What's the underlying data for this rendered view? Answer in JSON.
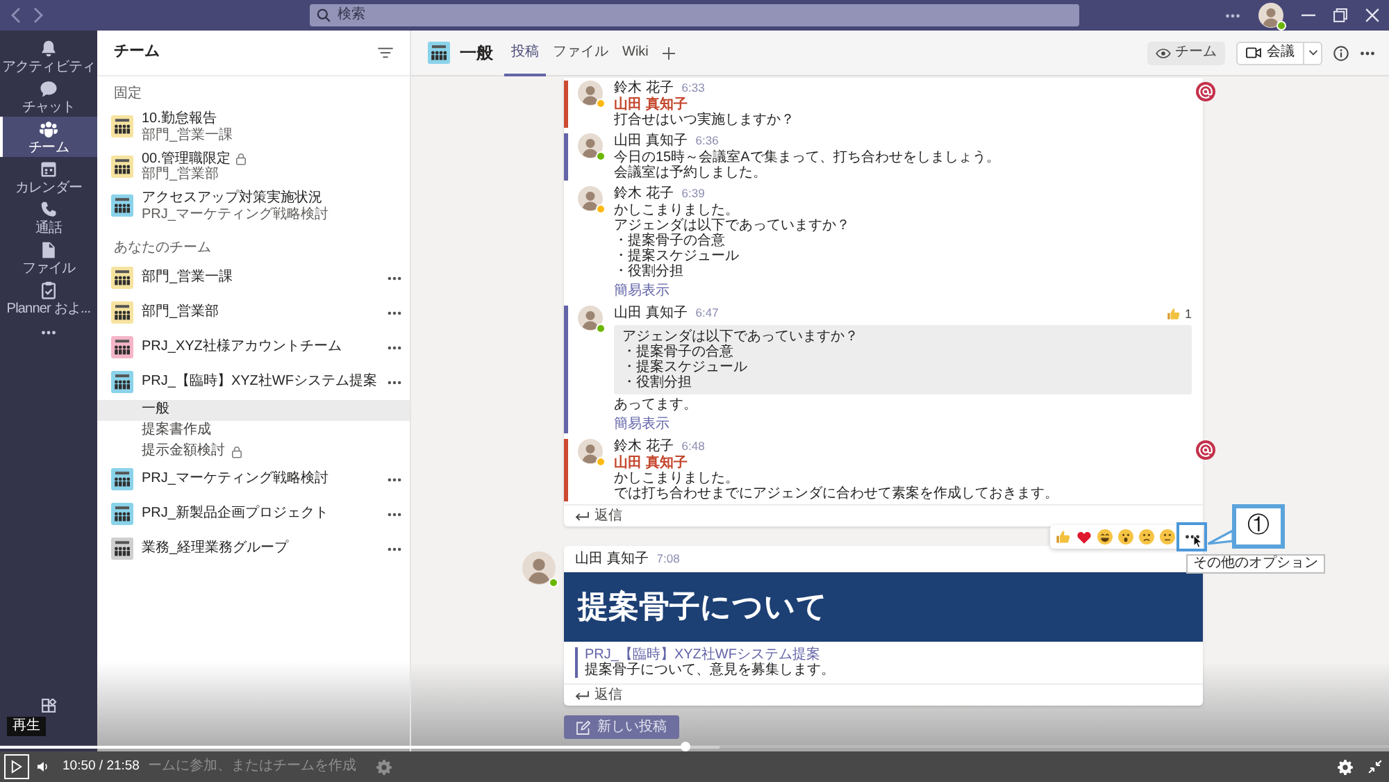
{
  "title_bar": {
    "search": {
      "placeholder": "検索"
    }
  },
  "rail": {
    "items": [
      {
        "label": "アクティビティ",
        "selected": false
      },
      {
        "label": "チャット",
        "selected": false
      },
      {
        "label": "チーム",
        "selected": true
      },
      {
        "label": "カレンダー",
        "selected": false
      },
      {
        "label": "通話",
        "selected": false
      },
      {
        "label": "ファイル",
        "selected": false
      },
      {
        "label": "Planner およ...",
        "selected": false
      }
    ]
  },
  "teams_panel": {
    "title": "チーム",
    "pinned": {
      "heading": "固定",
      "items": [
        {
          "name": "10.勤怠報告",
          "team": "部門_営業一課",
          "color": "#f6e3a0",
          "private": false
        },
        {
          "name": "00.管理職限定",
          "team": "部門_営業部",
          "color": "#f6e3a0",
          "private": true
        },
        {
          "name": "アクセスアップ対策実施状況",
          "team": "PRJ_マーケティング戦略検討",
          "color": "#8ad3ea",
          "private": false
        }
      ]
    },
    "your_teams": {
      "heading": "あなたのチーム",
      "items": [
        {
          "name": "部門_営業一課",
          "color": "#f6e3a0"
        },
        {
          "name": "部門_営業部",
          "color": "#f6e3a0"
        },
        {
          "name": "PRJ_XYZ社様アカウントチーム",
          "color": "#f5b5c8"
        },
        {
          "name": "PRJ_【臨時】XYZ社WFシステム提案",
          "color": "#8ad3ea",
          "channels": [
            {
              "name": "一般",
              "selected": true,
              "private": false
            },
            {
              "name": "提案書作成",
              "selected": false,
              "private": false
            },
            {
              "name": "提示金額検討",
              "selected": false,
              "private": true
            }
          ]
        },
        {
          "name": "PRJ_マーケティング戦略検討",
          "color": "#8ad3ea"
        },
        {
          "name": "PRJ_新製品企画プロジェクト",
          "color": "#8ad3ea"
        },
        {
          "name": "業務_経理業務グループ",
          "color": "#cfcfcf"
        }
      ]
    },
    "footer": {
      "text": "ームに参加、またはチームを作成"
    }
  },
  "channel_header": {
    "title": "一般",
    "tabs": [
      {
        "label": "投稿",
        "selected": true
      },
      {
        "label": "ファイル",
        "selected": false
      },
      {
        "label": "Wiki",
        "selected": false
      }
    ],
    "team_button": "チーム",
    "meeting_button": "会議"
  },
  "thread": {
    "messages": [
      {
        "kind": "mention",
        "author": "鈴木 花子",
        "time": "6:33",
        "avatar": {
          "color": "#fdb913"
        },
        "mention": "山田 真知子",
        "lines": [
          "打合せはいつ実施しますか？"
        ]
      },
      {
        "kind": "own",
        "author": "山田 真知子",
        "time": "6:36",
        "avatar": {
          "color": "#6bb700"
        },
        "lines": [
          "今日の15時～会議室Aで集まって、打ち合わせをしましょう。",
          "会議室は予約しました。"
        ]
      },
      {
        "kind": "plain",
        "author": "鈴木 花子",
        "time": "6:39",
        "avatar": {
          "color": "#fdb913"
        },
        "lines": [
          "かしこまりました。",
          "アジェンダは以下であっていますか？",
          "・提案骨子の合意",
          "・提案スケジュール",
          "・役割分担"
        ],
        "collapse": "簡易表示"
      },
      {
        "kind": "own",
        "author": "山田 真知子",
        "time": "6:47",
        "avatar": {
          "color": "#6bb700"
        },
        "quote": [
          "アジェンダは以下であっていますか？",
          "・提案骨子の合意",
          "・提案スケジュール",
          "・役割分担"
        ],
        "lines": [
          "あってます。"
        ],
        "reaction": {
          "count": "1"
        },
        "collapse": "簡易表示"
      },
      {
        "kind": "mention",
        "author": "鈴木 花子",
        "time": "6:48",
        "avatar": {
          "color": "#fdb913"
        },
        "mention": "山田 真知子",
        "lines": [
          "かしこまりました。",
          "では打ち合わせまでにアジェンダに合わせて素案を作成しておきます。"
        ]
      }
    ],
    "reply": "返信"
  },
  "post": {
    "author": "山田 真知子",
    "time": "7:08",
    "avatar": {
      "color": "#6bb700"
    },
    "banner": "提案骨子について",
    "link": "PRJ_【臨時】XYZ社WFシステム提案",
    "text": "提案骨子について、意見を募集します。",
    "reply": "返信"
  },
  "reaction_bar": {
    "tooltip": "その他のオプション"
  },
  "callout": {
    "label": "①"
  },
  "new_post_button": "新しい投稿",
  "player": {
    "tooltip": "再生",
    "time": "10:50 / 21:58",
    "progress": {
      "level": 0.493,
      "buffer": {
        "level": 0.518
      }
    }
  }
}
